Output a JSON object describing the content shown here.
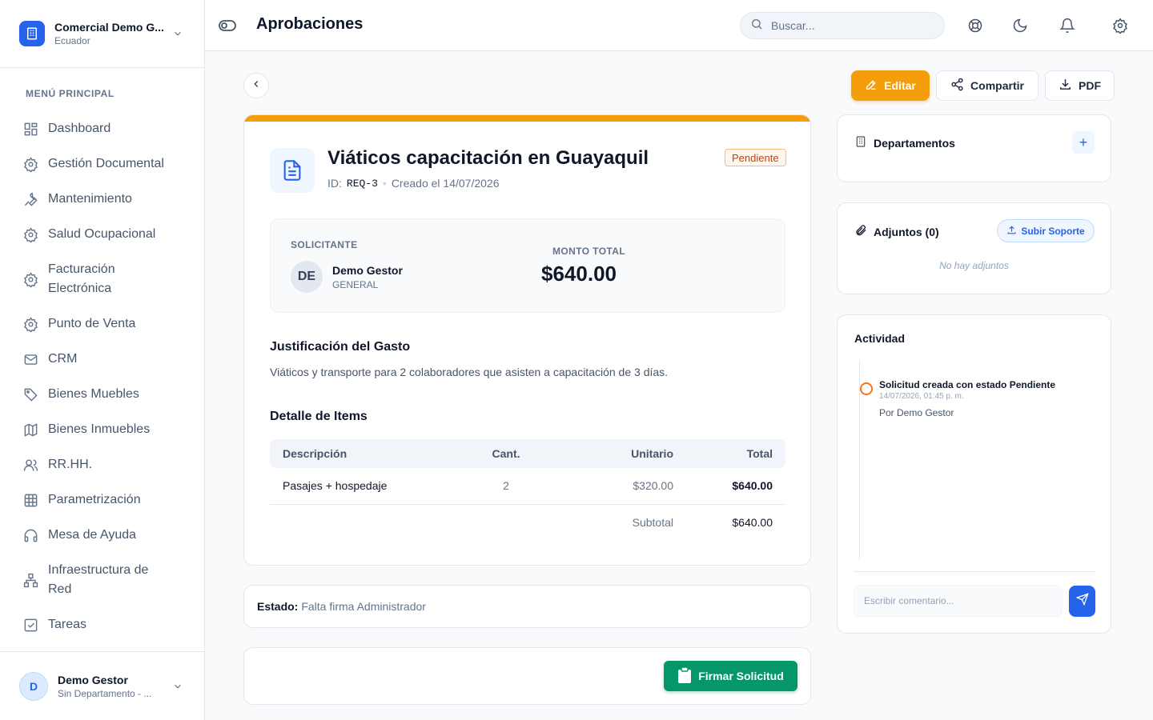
{
  "org": {
    "name": "Comercial Demo G...",
    "country": "Ecuador"
  },
  "menu": {
    "title": "MENÚ PRINCIPAL",
    "items": [
      {
        "label": "Dashboard",
        "icon": "dashboard-icon"
      },
      {
        "label": "Gestión Documental",
        "icon": "gear-icon"
      },
      {
        "label": "Mantenimiento",
        "icon": "wrench-icon"
      },
      {
        "label": "Salud Ocupacional",
        "icon": "gear-icon"
      },
      {
        "label": "Facturación Electrónica",
        "icon": "gear-icon"
      },
      {
        "label": "Punto de Venta",
        "icon": "gear-icon"
      },
      {
        "label": "CRM",
        "icon": "mail-icon"
      },
      {
        "label": "Bienes Muebles",
        "icon": "tag-icon"
      },
      {
        "label": "Bienes Inmuebles",
        "icon": "map-icon"
      },
      {
        "label": "RR.HH.",
        "icon": "users-icon"
      },
      {
        "label": "Parametrización",
        "icon": "grid-icon"
      },
      {
        "label": "Mesa de Ayuda",
        "icon": "headset-icon"
      },
      {
        "label": "Infraestructura de Red",
        "icon": "network-icon"
      },
      {
        "label": "Tareas",
        "icon": "checkbox-icon"
      }
    ]
  },
  "user": {
    "initial": "D",
    "name": "Demo Gestor",
    "subtitle": "Sin Departamento - ..."
  },
  "header": {
    "title": "Aprobaciones",
    "search_placeholder": "Buscar..."
  },
  "actions": {
    "edit": "Editar",
    "share": "Compartir",
    "pdf": "PDF"
  },
  "request": {
    "title": "Viáticos capacitación en Guayaquil",
    "id_label": "ID:",
    "id": "REQ-3",
    "created": "Creado el 14/07/2026",
    "status": "Pendiente",
    "accent_color": "#f59e0b"
  },
  "summary": {
    "requester_label": "SOLICITANTE",
    "requester_initials": "DE",
    "requester_name": "Demo Gestor",
    "requester_department": "GENERAL",
    "total_label": "MONTO TOTAL",
    "total": "$640.00"
  },
  "justification": {
    "title": "Justificación del Gasto",
    "text": "Viáticos y transporte para 2 colaboradores que asisten a capacitación de 3 días."
  },
  "items": {
    "title": "Detalle de Items",
    "columns": [
      "Descripción",
      "Cant.",
      "Unitario",
      "Total"
    ],
    "rows": [
      {
        "description": "Pasajes + hospedaje",
        "quantity": "2",
        "unit": "$320.00",
        "total": "$640.00"
      }
    ],
    "subtotal_label": "Subtotal",
    "subtotal": "$640.00"
  },
  "estado": {
    "label": "Estado:",
    "value": "Falta firma Administrador"
  },
  "sign_button": "Firmar Solicitud",
  "departments": {
    "title": "Departamentos",
    "add": "+"
  },
  "attachments": {
    "title": "Adjuntos (0)",
    "upload": "Subir Soporte",
    "empty": "No hay adjuntos"
  },
  "activity": {
    "title": "Actividad",
    "events": [
      {
        "title": "Solicitud creada con estado Pendiente",
        "time": "14/07/2026, 01:45 p. m.",
        "by": "Por Demo Gestor"
      }
    ],
    "comment_placeholder": "Escribir comentario..."
  }
}
